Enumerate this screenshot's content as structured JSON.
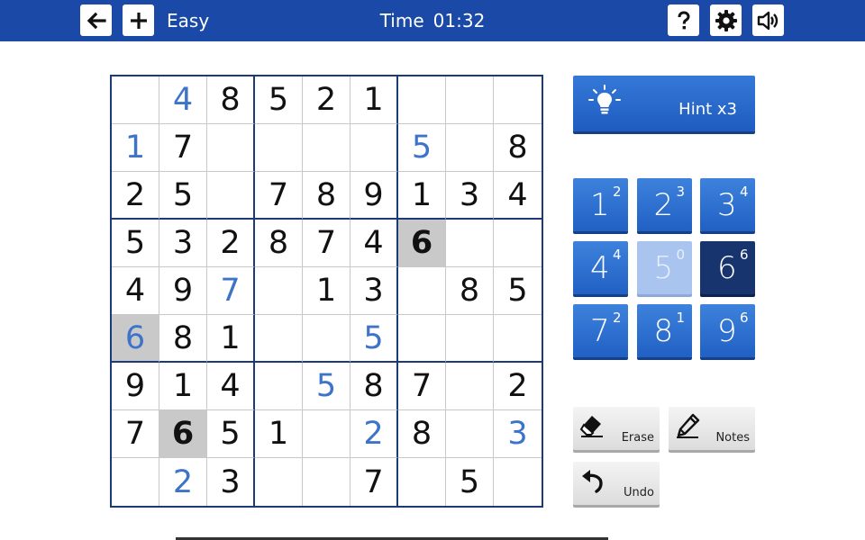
{
  "header": {
    "difficulty": "Easy",
    "time_label": "Time",
    "time_value": "01:32"
  },
  "board": {
    "rows": [
      [
        {
          "v": "",
          "t": "empty"
        },
        {
          "v": "4",
          "t": "user"
        },
        {
          "v": "8",
          "t": "given"
        },
        {
          "v": "5",
          "t": "given"
        },
        {
          "v": "2",
          "t": "given"
        },
        {
          "v": "1",
          "t": "given"
        },
        {
          "v": "",
          "t": "empty"
        },
        {
          "v": "",
          "t": "empty"
        },
        {
          "v": "",
          "t": "empty"
        }
      ],
      [
        {
          "v": "1",
          "t": "user"
        },
        {
          "v": "7",
          "t": "given"
        },
        {
          "v": "",
          "t": "empty"
        },
        {
          "v": "",
          "t": "empty"
        },
        {
          "v": "",
          "t": "empty"
        },
        {
          "v": "",
          "t": "empty"
        },
        {
          "v": "5",
          "t": "user"
        },
        {
          "v": "",
          "t": "empty"
        },
        {
          "v": "8",
          "t": "given"
        }
      ],
      [
        {
          "v": "2",
          "t": "given"
        },
        {
          "v": "5",
          "t": "given"
        },
        {
          "v": "",
          "t": "empty"
        },
        {
          "v": "7",
          "t": "given"
        },
        {
          "v": "8",
          "t": "given"
        },
        {
          "v": "9",
          "t": "given"
        },
        {
          "v": "1",
          "t": "given"
        },
        {
          "v": "3",
          "t": "given"
        },
        {
          "v": "4",
          "t": "given"
        }
      ],
      [
        {
          "v": "5",
          "t": "given"
        },
        {
          "v": "3",
          "t": "given"
        },
        {
          "v": "2",
          "t": "given"
        },
        {
          "v": "8",
          "t": "given"
        },
        {
          "v": "7",
          "t": "given"
        },
        {
          "v": "4",
          "t": "given"
        },
        {
          "v": "6",
          "t": "given",
          "hl": true,
          "sel": true
        },
        {
          "v": "",
          "t": "empty"
        },
        {
          "v": "",
          "t": "empty"
        }
      ],
      [
        {
          "v": "4",
          "t": "given"
        },
        {
          "v": "9",
          "t": "given"
        },
        {
          "v": "7",
          "t": "user"
        },
        {
          "v": "",
          "t": "empty"
        },
        {
          "v": "1",
          "t": "given"
        },
        {
          "v": "3",
          "t": "given"
        },
        {
          "v": "",
          "t": "empty"
        },
        {
          "v": "8",
          "t": "given"
        },
        {
          "v": "5",
          "t": "given"
        }
      ],
      [
        {
          "v": "6",
          "t": "user",
          "hl": true
        },
        {
          "v": "8",
          "t": "given"
        },
        {
          "v": "1",
          "t": "given"
        },
        {
          "v": "",
          "t": "empty"
        },
        {
          "v": "",
          "t": "empty"
        },
        {
          "v": "5",
          "t": "user"
        },
        {
          "v": "",
          "t": "empty"
        },
        {
          "v": "",
          "t": "empty"
        },
        {
          "v": "",
          "t": "empty"
        }
      ],
      [
        {
          "v": "9",
          "t": "given"
        },
        {
          "v": "1",
          "t": "given"
        },
        {
          "v": "4",
          "t": "given"
        },
        {
          "v": "",
          "t": "empty"
        },
        {
          "v": "5",
          "t": "user"
        },
        {
          "v": "8",
          "t": "given"
        },
        {
          "v": "7",
          "t": "given"
        },
        {
          "v": "",
          "t": "empty"
        },
        {
          "v": "2",
          "t": "given"
        }
      ],
      [
        {
          "v": "7",
          "t": "given"
        },
        {
          "v": "6",
          "t": "given",
          "hl": true,
          "sel": true
        },
        {
          "v": "5",
          "t": "given"
        },
        {
          "v": "1",
          "t": "given"
        },
        {
          "v": "",
          "t": "empty"
        },
        {
          "v": "2",
          "t": "user"
        },
        {
          "v": "8",
          "t": "given"
        },
        {
          "v": "",
          "t": "empty"
        },
        {
          "v": "3",
          "t": "user"
        }
      ],
      [
        {
          "v": "",
          "t": "empty"
        },
        {
          "v": "2",
          "t": "user"
        },
        {
          "v": "3",
          "t": "given"
        },
        {
          "v": "",
          "t": "empty"
        },
        {
          "v": "",
          "t": "empty"
        },
        {
          "v": "7",
          "t": "given"
        },
        {
          "v": "",
          "t": "empty"
        },
        {
          "v": "5",
          "t": "given"
        },
        {
          "v": "",
          "t": "empty"
        }
      ]
    ]
  },
  "hint": {
    "label": "Hint x3"
  },
  "numpad": [
    {
      "digit": "1",
      "count": "2",
      "state": "normal"
    },
    {
      "digit": "2",
      "count": "3",
      "state": "normal"
    },
    {
      "digit": "3",
      "count": "4",
      "state": "normal"
    },
    {
      "digit": "4",
      "count": "4",
      "state": "normal"
    },
    {
      "digit": "5",
      "count": "0",
      "state": "done"
    },
    {
      "digit": "6",
      "count": "6",
      "state": "active"
    },
    {
      "digit": "7",
      "count": "2",
      "state": "normal"
    },
    {
      "digit": "8",
      "count": "1",
      "state": "normal"
    },
    {
      "digit": "9",
      "count": "6",
      "state": "normal"
    }
  ],
  "tools": {
    "erase_label": "Erase",
    "notes_label": "Notes",
    "undo_label": "Undo"
  },
  "icons": {
    "back": "arrow-left-icon",
    "new": "plus-icon",
    "help": "question-icon",
    "settings": "gear-icon",
    "sound": "speaker-icon",
    "hint": "lightbulb-icon",
    "erase": "eraser-icon",
    "notes": "pencil-icon",
    "undo": "undo-icon"
  },
  "colors": {
    "header": "#1a49a8",
    "given_digit": "#111111",
    "user_digit": "#3d73c9",
    "highlight": "#c9c9c9",
    "numpad_active": "#17346e",
    "numpad_done": "#a9c4ee"
  }
}
